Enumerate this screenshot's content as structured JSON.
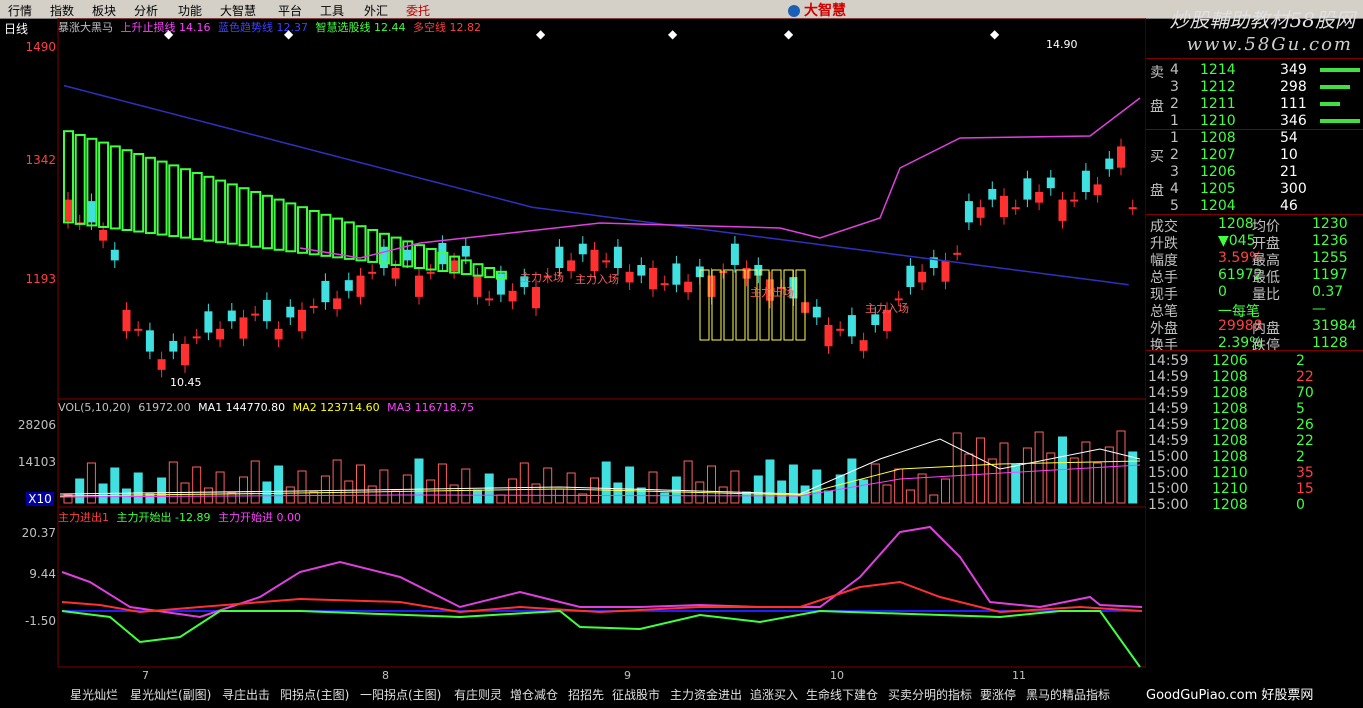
{
  "menu": [
    "行情",
    "指数",
    "板块",
    "分析",
    "功能",
    "大智慧",
    "平台",
    "工具",
    "外汇",
    "委托"
  ],
  "brand": "大智慧",
  "watermark": {
    "line1": "炒股輔助教材58股网",
    "line2": "www.58Gu.com"
  },
  "chart": {
    "period": "日线",
    "indicators_line": [
      {
        "text": "暴涨大黑马",
        "color": "#c0c0c0"
      },
      {
        "text": "上升止损线 14.16",
        "color": "#ff40ff"
      },
      {
        "text": "蓝色趋势线 12.37",
        "color": "#4040ff"
      },
      {
        "text": "智慧选股线 12.44",
        "color": "#40ff40"
      },
      {
        "text": "多空线 12.82",
        "color": "#ff4040"
      }
    ],
    "price_axis": [
      "1490",
      "1342",
      "1193"
    ],
    "high_label": "14.90",
    "low_label": "10.45",
    "annotations": [
      "主力入场",
      "主力入场",
      "主力出场",
      "主力入场"
    ],
    "vol_header": [
      {
        "text": "VOL(5,10,20)",
        "color": "#c0c0c0"
      },
      {
        "text": "61972.00",
        "color": "#c0c0c0"
      },
      {
        "text": "MA1 144770.80",
        "color": "#ffffff"
      },
      {
        "text": "MA2 123714.60",
        "color": "#ffff00"
      },
      {
        "text": "MA3 116718.75",
        "color": "#ff40ff"
      }
    ],
    "vol_axis": [
      "28206",
      "14103",
      "X10"
    ],
    "ind_header": [
      {
        "text": "主力进出1",
        "color": "#ff4040"
      },
      {
        "text": "主力开始出 -12.89",
        "color": "#40ff40"
      },
      {
        "text": "主力开始进 0.00",
        "color": "#ff40ff"
      }
    ],
    "ind_axis": [
      "20.37",
      "9.44",
      "-1.50"
    ],
    "x_months": [
      "7",
      "8",
      "9",
      "10",
      "11"
    ]
  },
  "orderbook": {
    "sell_label": [
      "卖",
      "盘"
    ],
    "buy_label": [
      "买",
      "盘"
    ],
    "sells": [
      {
        "lvl": "4",
        "price": "1214",
        "vol": "349"
      },
      {
        "lvl": "3",
        "price": "1212",
        "vol": "298"
      },
      {
        "lvl": "2",
        "price": "1211",
        "vol": "111"
      },
      {
        "lvl": "1",
        "price": "1210",
        "vol": "346"
      }
    ],
    "buys": [
      {
        "lvl": "1",
        "price": "1208",
        "vol": "54"
      },
      {
        "lvl": "2",
        "price": "1207",
        "vol": "10"
      },
      {
        "lvl": "3",
        "price": "1206",
        "vol": "21"
      },
      {
        "lvl": "4",
        "price": "1205",
        "vol": "300"
      },
      {
        "lvl": "5",
        "price": "1204",
        "vol": "46"
      }
    ]
  },
  "quote": [
    {
      "k1": "成交",
      "v1": "1208",
      "k2": "均价",
      "v2": "1230"
    },
    {
      "k1": "升跌",
      "v1": "▼045",
      "k2": "开盘",
      "v2": "1236"
    },
    {
      "k1": "幅度",
      "v1": "3.59%",
      "k2": "最高",
      "v2": "1255"
    },
    {
      "k1": "总手",
      "v1": "61972",
      "k2": "最低",
      "v2": "1197"
    },
    {
      "k1": "现手",
      "v1": "0",
      "k2": "量比",
      "v2": "0.37"
    },
    {
      "k1": "总笔",
      "v1": "一每笔",
      "k2": "",
      "v2": "—"
    },
    {
      "k1": "外盘",
      "v1": "29988",
      "k2": "内盘",
      "v2": "31984"
    },
    {
      "k1": "换手",
      "v1": "2.39%",
      "k2": "跌停",
      "v2": "1128"
    }
  ],
  "ticks": [
    {
      "t": "14:59",
      "p": "1206",
      "v": "2"
    },
    {
      "t": "14:59",
      "p": "1208",
      "v": "22"
    },
    {
      "t": "14:59",
      "p": "1208",
      "v": "70"
    },
    {
      "t": "14:59",
      "p": "1208",
      "v": "5"
    },
    {
      "t": "14:59",
      "p": "1208",
      "v": "26"
    },
    {
      "t": "14:59",
      "p": "1208",
      "v": "22"
    },
    {
      "t": "15:00",
      "p": "1208",
      "v": "2"
    },
    {
      "t": "15:00",
      "p": "1210",
      "v": "35"
    },
    {
      "t": "15:00",
      "p": "1210",
      "v": "15"
    },
    {
      "t": "15:00",
      "p": "1208",
      "v": "0"
    }
  ],
  "tabs": [
    "星光灿烂",
    "星光灿烂(副图)",
    "寻庄出击",
    "阳拐点(主图)",
    "一阳拐点(主图)",
    "有庄则灵",
    "增仓减仓",
    "招招先",
    "征战股市",
    "主力资金进出",
    "追涨买入",
    "生命线下建仓",
    "买卖分明的指标",
    "要涨停",
    "黑马的精品指标"
  ],
  "footer_watermark": "GoodGuPiao.com 好股票网"
}
